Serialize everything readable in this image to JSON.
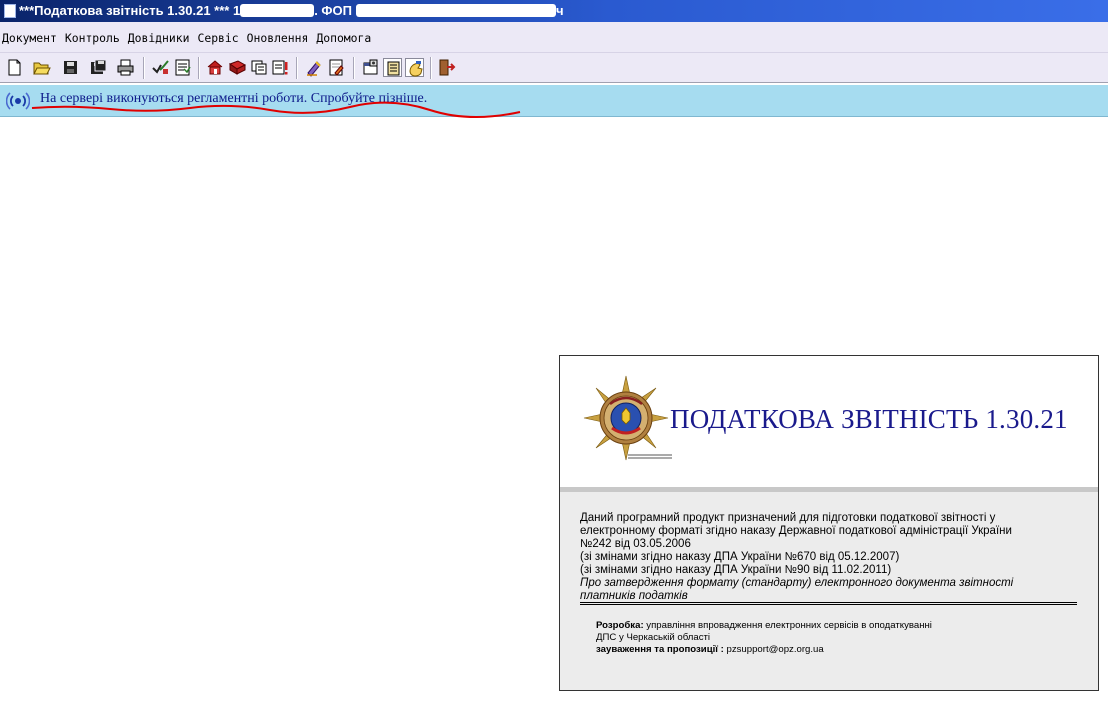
{
  "window": {
    "title_part1": "***Податкова звітність 1.30.21 *** 1",
    "title_part2": ". ФОП",
    "title_part3": "ч"
  },
  "menu": [
    "Документ",
    "Контроль",
    "Довідники",
    "Сервіс",
    "Оновлення",
    "Допомога"
  ],
  "toolbar": {
    "icons": [
      "new-document-icon",
      "open-folder-icon",
      "save-icon",
      "save-as-icon",
      "print-icon",
      "check-icon",
      "report-icon",
      "home-icon",
      "book-icon",
      "copy-icon",
      "alert-icon",
      "sign-icon",
      "edit-document-icon",
      "properties-icon",
      "list-icon",
      "hand-icon",
      "exit-icon"
    ]
  },
  "notice": {
    "icon": "broadcast-icon",
    "text": "На сервері виконуються регламентні роботи. Спробуйте пізніше.",
    "bg_color": "#a6dcf0",
    "text_color": "#0d1a8a",
    "underline_color": "#e00000"
  },
  "splash": {
    "emblem": "tax-service-emblem",
    "title": "ПОДАТКОВА ЗВІТНІСТЬ 1.30.21",
    "title_color": "#1a1a8c",
    "desc_lines": [
      "Даний програмний продукт призначений для підготовки податкової звітності у",
      "електронному форматі згідно наказу Державної податкової адміністрації України",
      "№242 від 03.05.2006",
      "(зі змінами згідно наказу ДПА України №670 від 05.12.2007)",
      "(зі змінами згідно наказу ДПА України №90 від 11.02.2011)"
    ],
    "desc_italic_1": "Про затвердження формату (стандарту) електронного документа звітності",
    "desc_italic_2": "платників податків",
    "credits": {
      "dev_label": "Розробка:",
      "dev_text": " управління впровадження електронних сервісів в оподаткуванні",
      "dev_text2": "ДПС у Черкаській області",
      "contact_label": "зауваження та пропозиції :",
      "contact_text": " pzsupport@opz.org.ua"
    }
  }
}
